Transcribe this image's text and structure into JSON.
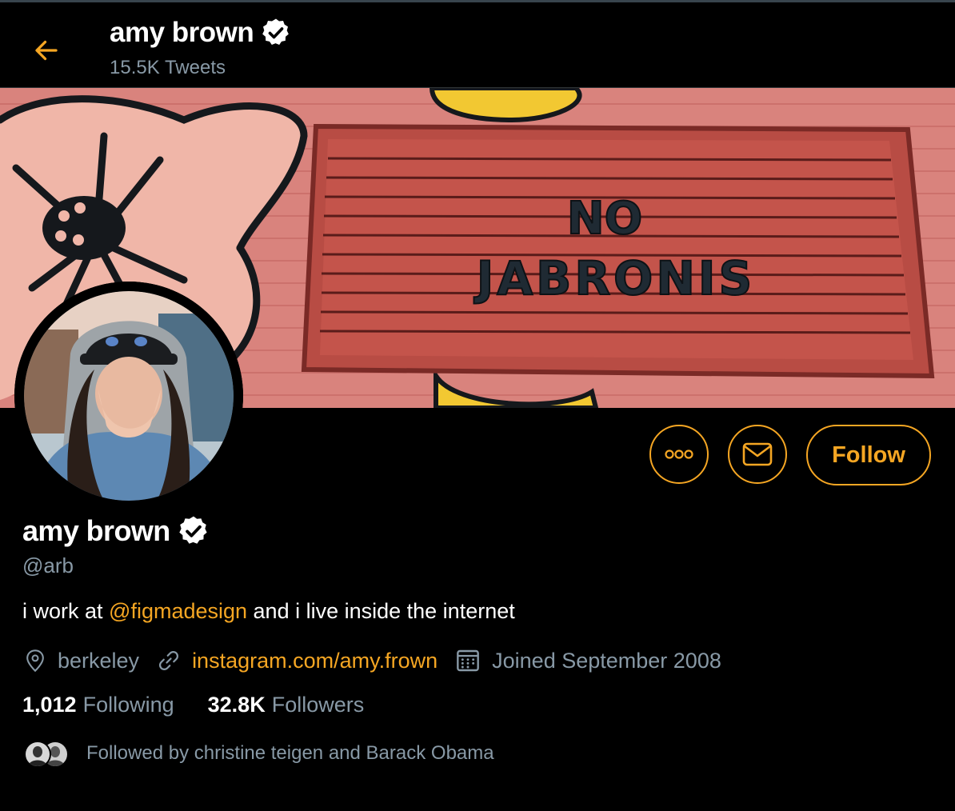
{
  "header": {
    "back_icon": "arrow-left-icon",
    "name": "amy brown",
    "verified_icon": "verified-badge-icon",
    "tweet_count": "15.5K Tweets"
  },
  "banner": {
    "sign_line1": "NO",
    "sign_line2": "JABRONIS"
  },
  "actions": {
    "more_icon": "more-icon",
    "message_icon": "envelope-icon",
    "follow_label": "Follow"
  },
  "profile": {
    "name": "amy brown",
    "handle": "@arb",
    "bio_before": "i work at ",
    "bio_mention": "@figmadesign",
    "bio_after": " and i live inside the internet",
    "location": "berkeley",
    "website": "instagram.com/amy.frown",
    "joined": "Joined September 2008",
    "following_count": "1,012",
    "following_label": "Following",
    "followers_count": "32.8K",
    "followers_label": "Followers",
    "followed_by": "Followed by christine teigen and Barack Obama"
  },
  "colors": {
    "accent": "#f5a623",
    "muted": "#8899a6",
    "background": "#000000"
  }
}
